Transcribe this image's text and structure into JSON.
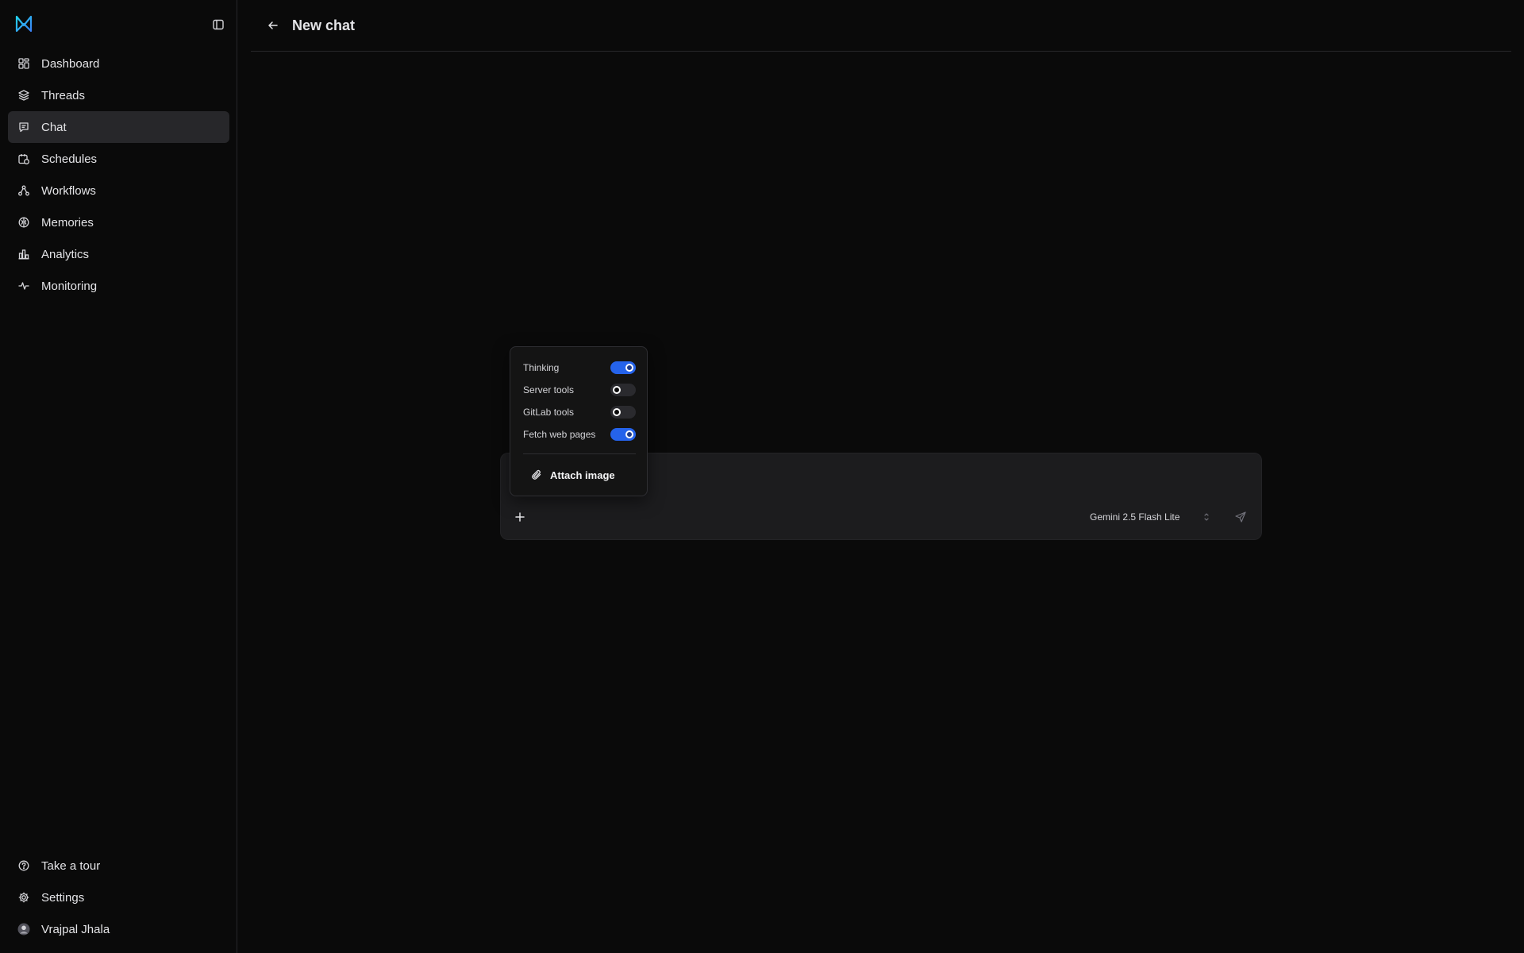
{
  "sidebar": {
    "nav_items": [
      {
        "label": "Dashboard",
        "icon": "grid-icon"
      },
      {
        "label": "Threads",
        "icon": "layers-icon"
      },
      {
        "label": "Chat",
        "icon": "chat-icon",
        "active": true
      },
      {
        "label": "Schedules",
        "icon": "calendar-clock-icon"
      },
      {
        "label": "Workflows",
        "icon": "workflow-icon"
      },
      {
        "label": "Memories",
        "icon": "brain-icon"
      },
      {
        "label": "Analytics",
        "icon": "bar-chart-icon"
      },
      {
        "label": "Monitoring",
        "icon": "activity-icon"
      }
    ],
    "bottom_items": [
      {
        "label": "Take a tour",
        "icon": "help-circle-icon"
      },
      {
        "label": "Settings",
        "icon": "gear-icon"
      },
      {
        "label": "Vrajpal Jhala",
        "icon": "avatar"
      }
    ]
  },
  "header": {
    "title": "New chat"
  },
  "composer": {
    "model": "Gemini 2.5 Flash Lite"
  },
  "options_popover": {
    "options": [
      {
        "label": "Thinking",
        "enabled": true
      },
      {
        "label": "Server tools",
        "enabled": false
      },
      {
        "label": "GitLab tools",
        "enabled": false
      },
      {
        "label": "Fetch web pages",
        "enabled": true
      }
    ],
    "attach_label": "Attach image"
  },
  "colors": {
    "background": "#0a0a0a",
    "accent": "#2563eb",
    "active_nav": "#27272a",
    "logo": "#3b82f6"
  }
}
